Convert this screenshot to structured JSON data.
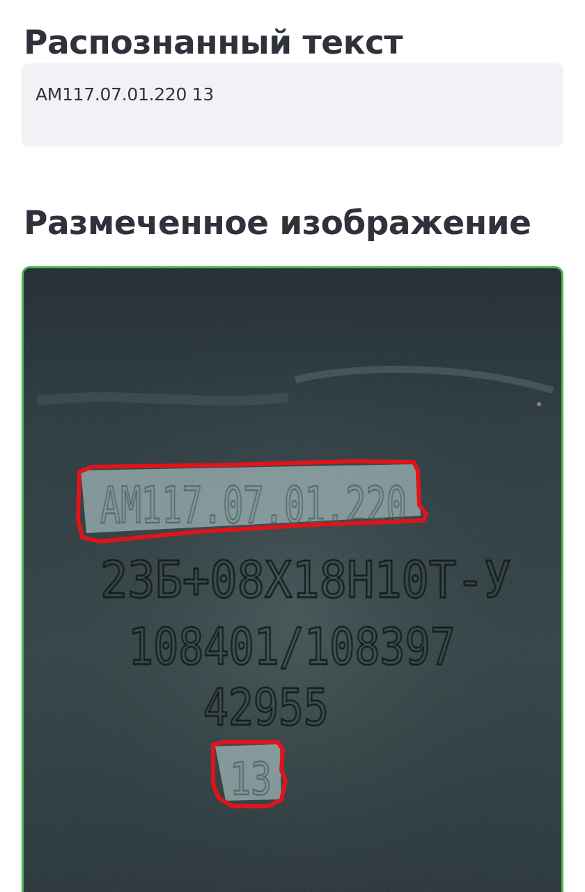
{
  "recognized": {
    "title": "Распознанный текст",
    "value": "AM117.07.01.220 13"
  },
  "marked": {
    "title": "Размеченное изображение",
    "image_alt": "Marked plate photo",
    "plate_lines": [
      "AM117.07.01.220",
      "23Б+08Х18Н10Т-У",
      "108401/108397",
      "42955",
      "13"
    ],
    "detections": [
      {
        "label": "AM117.07.01.220"
      },
      {
        "label": "13"
      }
    ],
    "colors": {
      "frame_border": "#4fb64c",
      "detection_outline": "#e0141b",
      "text_box_bg": "#f0f2f6",
      "title_color": "#2f323b"
    }
  }
}
